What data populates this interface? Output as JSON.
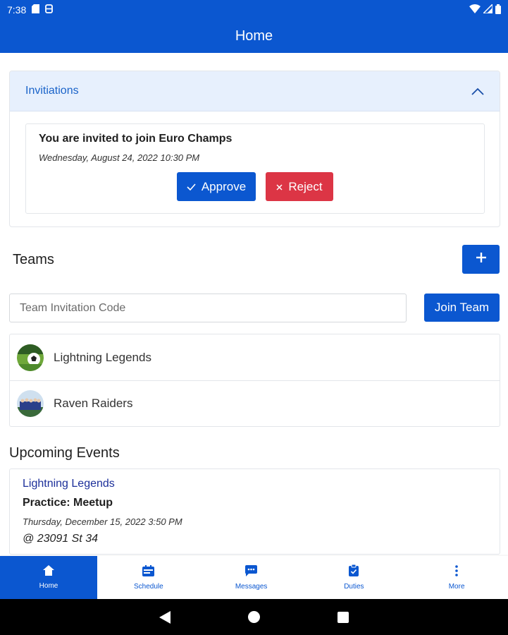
{
  "status_bar": {
    "time": "7:38"
  },
  "app_bar": {
    "title": "Home"
  },
  "invitations": {
    "header": "Invitiations",
    "items": [
      {
        "title": "You are invited to join Euro Champs",
        "date": "Wednesday, August 24, 2022 10:30 PM",
        "approve_label": "Approve",
        "reject_label": "Reject"
      }
    ]
  },
  "teams": {
    "title": "Teams",
    "code_placeholder": "Team Invitation Code",
    "join_label": "Join Team",
    "list": [
      {
        "name": "Lightning Legends"
      },
      {
        "name": "Raven Raiders"
      }
    ]
  },
  "events": {
    "title": "Upcoming Events",
    "items": [
      {
        "team": "Lightning Legends",
        "title": "Practice: Meetup",
        "date": "Thursday, December 15, 2022 3:50 PM",
        "location": "@ 23091 St 34"
      }
    ]
  },
  "bottom_nav": {
    "items": [
      {
        "label": "Home",
        "icon": "home-icon"
      },
      {
        "label": "Schedule",
        "icon": "calendar-icon"
      },
      {
        "label": "Messages",
        "icon": "chat-icon"
      },
      {
        "label": "Duties",
        "icon": "clipboard-icon"
      },
      {
        "label": "More",
        "icon": "more-vertical-icon"
      }
    ]
  },
  "colors": {
    "primary": "#0b57d0",
    "danger": "#dc3545",
    "header_bg": "#e7f0fd",
    "event_team": "#1c2f9a"
  }
}
